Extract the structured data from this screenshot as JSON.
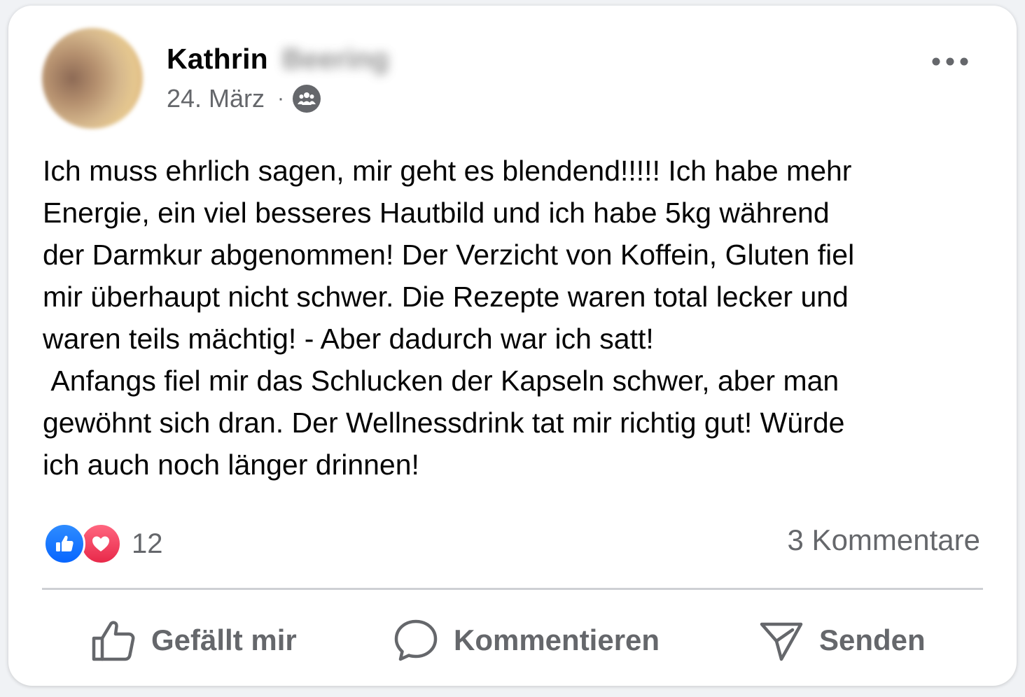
{
  "post": {
    "author_first_name": "Kathrin",
    "author_last_name_blurred": "Beering",
    "date": "24. März",
    "separator": "·",
    "audience_icon": "group-icon",
    "more_icon": "more-horizontal-icon",
    "text": "Ich muss ehrlich sagen, mir geht es blendend!!!!! Ich habe mehr\nEnergie, ein viel besseres Hautbild und ich habe 5kg während\nder Darmkur abgenommen! Der Verzicht von Koffein, Gluten fiel\nmir überhaupt nicht schwer. Die Rezepte waren total lecker und\nwaren teils mächtig! - Aber dadurch war ich satt!\n Anfangs fiel mir das Schlucken der Kapseln schwer, aber man\ngewöhnt sich dran. Der Wellnessdrink tat mir richtig gut! Würde\nich auch noch länger drinnen!"
  },
  "reactions": {
    "types": [
      "like",
      "love"
    ],
    "count": "12",
    "comments_label": "3 Kommentare"
  },
  "actions": {
    "like_label": "Gefällt mir",
    "comment_label": "Kommentieren",
    "send_label": "Senden"
  },
  "colors": {
    "text_primary": "#050505",
    "text_secondary": "#65676b",
    "like_blue": "#0866ff",
    "love_red": "#e8294a",
    "divider": "#ced0d4"
  }
}
